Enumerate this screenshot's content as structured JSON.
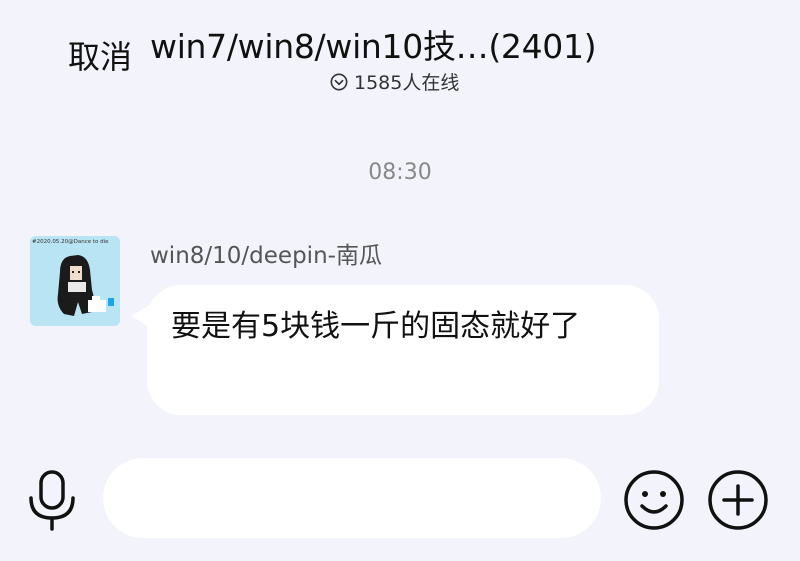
{
  "header": {
    "cancel_label": "取消",
    "title": "win7/win8/win10技…(2401)",
    "online_count": "1585人在线",
    "online_icon": "chevron-down-circle-icon"
  },
  "chat": {
    "timestamp": "08:30",
    "messages": [
      {
        "sender": "win8/10/deepin-南瓜",
        "avatar_caption": "#2020.05.20@Dance to die",
        "text": "要是有5块钱一斤的固态就好了"
      }
    ]
  },
  "input_bar": {
    "mic_icon": "microphone-icon",
    "input_value": "",
    "emoji_icon": "smiley-icon",
    "plus_icon": "plus-circle-icon"
  },
  "colors": {
    "background": "#f3f4fb",
    "bubble": "#ffffff",
    "text": "#111111",
    "secondary_text": "#555555",
    "timestamp": "#888888"
  }
}
